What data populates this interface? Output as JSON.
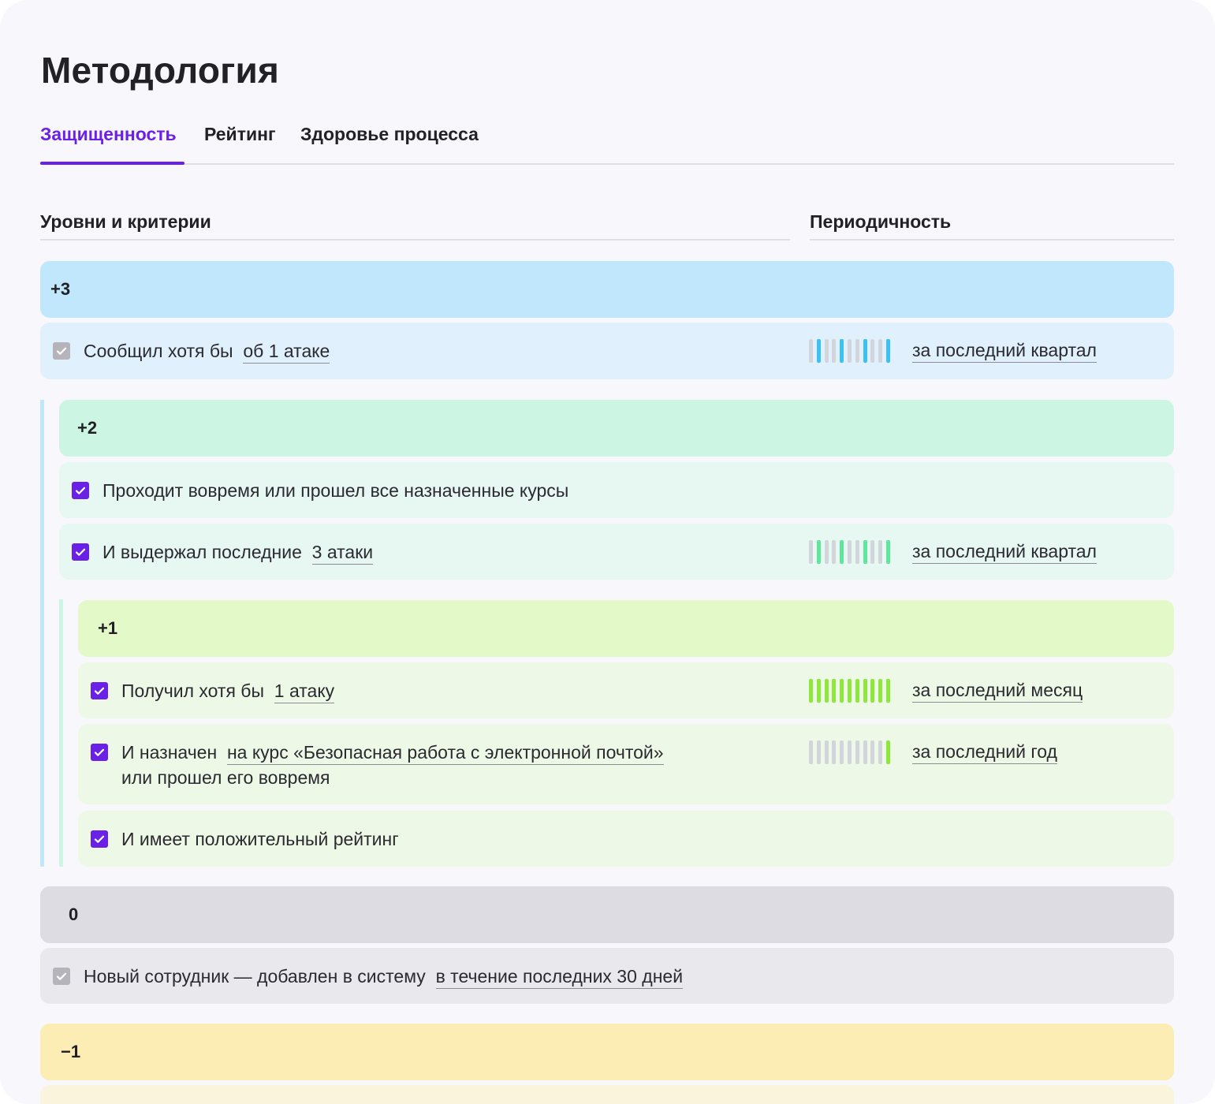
{
  "title": "Методология",
  "tabs": [
    {
      "label": "Защищенность",
      "active": true
    },
    {
      "label": "Рейтинг",
      "active": false
    },
    {
      "label": "Здоровье процесса",
      "active": false
    }
  ],
  "columns": {
    "criteria": "Уровни и критерии",
    "period": "Периодичность"
  },
  "colors": {
    "accent": "#6a20e6",
    "level_p3": "#c1e7fc",
    "row_p3": "#e0f0fc",
    "level_p2": "#cdf5e3",
    "row_p2": "#e7f7f1",
    "level_p1": "#e3f9c7",
    "row_p1": "#eef8e6",
    "level_0": "#dcdce2",
    "row_0": "#e8e8ed",
    "level_m1": "#fbedb4"
  },
  "levels": {
    "p3": {
      "label": "+3",
      "rows": [
        {
          "checked": true,
          "disabled": true,
          "prefix": "Сообщил хотя бы",
          "link": "об 1 атаке",
          "period": "за последний квартал",
          "bar_color": "#3ec0f5",
          "active_bars": [
            1,
            4,
            7,
            10
          ]
        }
      ]
    },
    "p2": {
      "label": "+2",
      "rows": [
        {
          "checked": true,
          "text": "Проходит вовремя или прошел все назначенные курсы"
        },
        {
          "checked": true,
          "prefix": "И выдержал последние",
          "link": "3 атаки",
          "period": "за последний квартал",
          "bar_color": "#5fe59c",
          "active_bars": [
            1,
            4,
            7,
            10
          ]
        }
      ]
    },
    "p1": {
      "label": "+1",
      "rows": [
        {
          "checked": true,
          "prefix": "Получил хотя бы",
          "link": "1 атаку",
          "period": "за последний месяц",
          "bar_color": "#8ee83c",
          "active_bars": [
            0,
            1,
            2,
            3,
            4,
            5,
            6,
            7,
            8,
            9,
            10
          ]
        },
        {
          "checked": true,
          "prefix": "И назначен",
          "link": "на курс «Безопасная работа с электронной почтой»",
          "line2": "или прошел его вовремя",
          "period": "за последний год",
          "bar_color": "#8ee83c",
          "active_bars": [
            10
          ]
        },
        {
          "checked": true,
          "text": "И имеет положительный рейтинг"
        }
      ]
    },
    "zero": {
      "label": "0",
      "rows": [
        {
          "checked": true,
          "disabled": true,
          "prefix": "Новый сотрудник — добавлен в систему",
          "link": "в течение последних 30 дней"
        }
      ]
    },
    "m1": {
      "label": "−1"
    }
  }
}
